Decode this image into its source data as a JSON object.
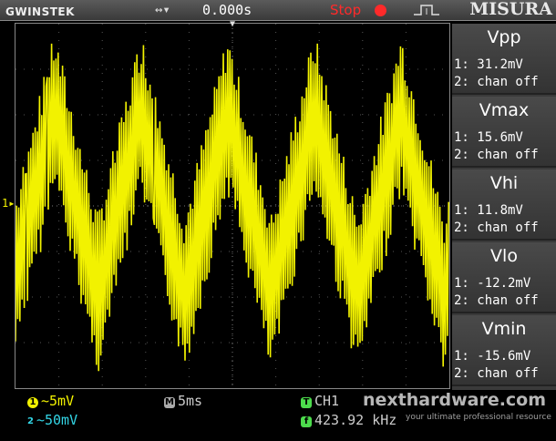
{
  "topbar": {
    "brand": "GWINSTEK",
    "timebase_icon": "↔▾",
    "trigger_delay": "0.000s",
    "status": "Stop",
    "trigger_icon": "rising-edge-icon",
    "title": "MISURA"
  },
  "measurements": [
    {
      "title": "Vpp",
      "line1": "1: 31.2mV",
      "line2": "2: chan off"
    },
    {
      "title": "Vmax",
      "line1": "1: 15.6mV",
      "line2": "2: chan off"
    },
    {
      "title": "Vhi",
      "line1": "1: 11.8mV",
      "line2": "2: chan off"
    },
    {
      "title": "Vlo",
      "line1": "1: -12.2mV",
      "line2": "2: chan off"
    },
    {
      "title": "Vmin",
      "line1": "1: -15.6mV",
      "line2": "2: chan off"
    }
  ],
  "bottombar": {
    "ch1_badge": "1",
    "ch1_scale": "~5mV",
    "ch2_badge": "2",
    "ch2_scale": "~50mV",
    "time_badge": "M",
    "time_div": "5ms",
    "trig_badge": "T",
    "trig_source": "CH1",
    "freq_badge": "f",
    "frequency": "423.92 kHz"
  },
  "ground_marker": "1▸",
  "trigger_marker": "▼",
  "watermark": {
    "line1": "nexthardware.com",
    "line2": "your ultimate professional resource"
  },
  "colors": {
    "ch1": "#f2f200",
    "ch2": "#33d6e6",
    "status": "#ff2a2a",
    "trigger": "#4cdc4c"
  }
}
